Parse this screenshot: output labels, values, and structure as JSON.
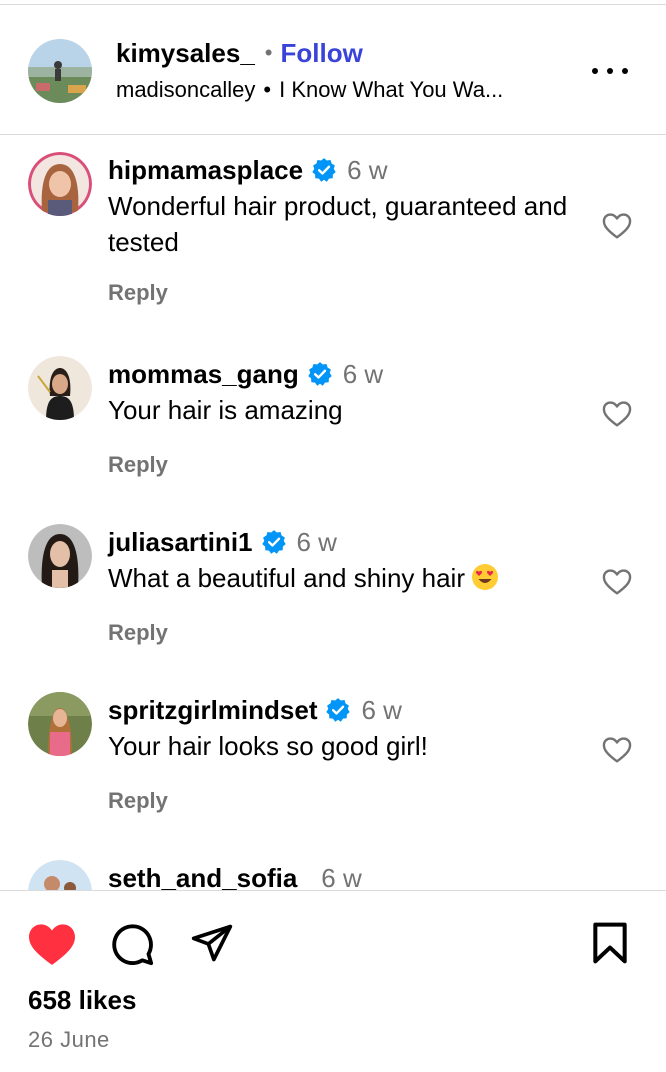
{
  "post_header": {
    "username": "kimysales_",
    "separator": "•",
    "follow_label": "Follow",
    "audio_user": "madisoncalley",
    "audio_separator": "•",
    "audio_title": "I Know What You Wa...",
    "more_icon": "more-horizontal-icon"
  },
  "comments": [
    {
      "username": "hipmamasplace",
      "verified": true,
      "time": "6 w",
      "text": "Wonderful hair product, guaranteed and tested",
      "reply_label": "Reply",
      "liked": false
    },
    {
      "username": "mommas_gang",
      "verified": true,
      "time": "6 w",
      "text": "Your hair is amazing",
      "reply_label": "Reply",
      "liked": false
    },
    {
      "username": "juliasartini1",
      "verified": true,
      "time": "6 w",
      "text": "What a beautiful and shiny hair",
      "emoji": "😍",
      "reply_label": "Reply",
      "liked": false
    },
    {
      "username": "spritzgirlmindset",
      "verified": true,
      "time": "6 w",
      "text": "Your hair looks so good girl!",
      "reply_label": "Reply",
      "liked": false
    },
    {
      "username": "seth_and_sofia",
      "verified": false,
      "time": "6 w",
      "text": "",
      "reply_label": "",
      "liked": false
    }
  ],
  "actions": {
    "like_icon": "heart-filled-icon",
    "comment_icon": "comment-bubble-icon",
    "share_icon": "paper-plane-icon",
    "save_icon": "bookmark-icon",
    "likes_text": "658 likes",
    "date_text": "26 June"
  },
  "colors": {
    "follow_blue": "#3943d9",
    "verified_blue": "#0095f6",
    "like_red": "#ff3040",
    "secondary_text": "#737373",
    "divider": "#dbdbdb"
  }
}
